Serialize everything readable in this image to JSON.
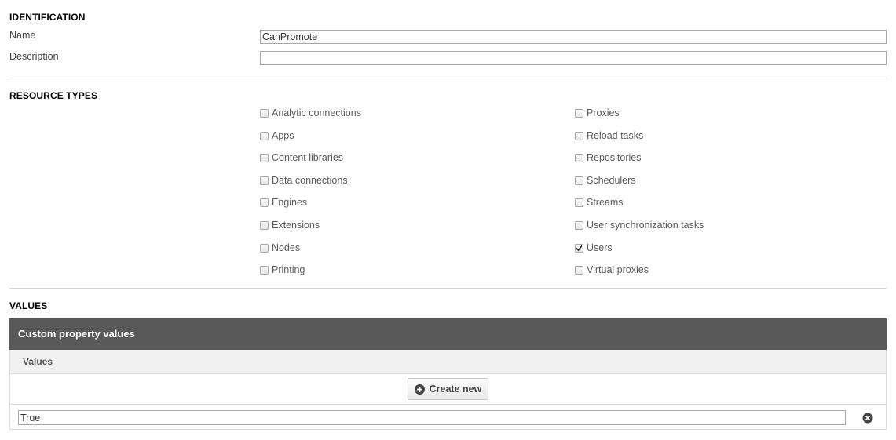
{
  "identification": {
    "title": "IDENTIFICATION",
    "name_label": "Name",
    "name_value": "CanPromote",
    "description_label": "Description",
    "description_value": ""
  },
  "resource_types": {
    "title": "RESOURCE TYPES",
    "left_column": [
      {
        "label": "Analytic connections",
        "checked": false
      },
      {
        "label": "Apps",
        "checked": false
      },
      {
        "label": "Content libraries",
        "checked": false
      },
      {
        "label": "Data connections",
        "checked": false
      },
      {
        "label": "Engines",
        "checked": false
      },
      {
        "label": "Extensions",
        "checked": false
      },
      {
        "label": "Nodes",
        "checked": false
      },
      {
        "label": "Printing",
        "checked": false
      }
    ],
    "right_column": [
      {
        "label": "Proxies",
        "checked": false
      },
      {
        "label": "Reload tasks",
        "checked": false
      },
      {
        "label": "Repositories",
        "checked": false
      },
      {
        "label": "Schedulers",
        "checked": false
      },
      {
        "label": "Streams",
        "checked": false
      },
      {
        "label": "User synchronization tasks",
        "checked": false
      },
      {
        "label": "Users",
        "checked": true
      },
      {
        "label": "Virtual proxies",
        "checked": false
      }
    ]
  },
  "values": {
    "title": "VALUES",
    "panel_title": "Custom property values",
    "column_header": "Values",
    "create_label": "Create new",
    "items": [
      {
        "value": "True"
      }
    ]
  },
  "colors": {
    "panel_header_bg": "#595959",
    "subheader_bg": "#f0f0f0"
  }
}
